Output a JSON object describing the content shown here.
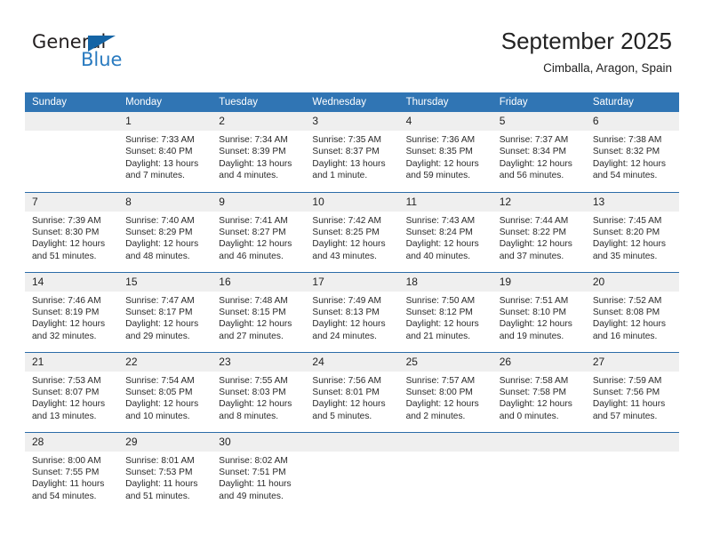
{
  "brand": {
    "name_part1": "General",
    "name_part2": "Blue",
    "accent_color": "#2a7bc0",
    "triangle_color": "#1464a5",
    "logo_icon": "triangle-play-icon"
  },
  "header": {
    "title": "September 2025",
    "subtitle": "Cimballa, Aragon, Spain"
  },
  "theme": {
    "header_row_bg": "#3075b4",
    "row_divider": "#2c6ca8",
    "daynum_bg": "#efefef"
  },
  "weekday_headers": [
    "Sunday",
    "Monday",
    "Tuesday",
    "Wednesday",
    "Thursday",
    "Friday",
    "Saturday"
  ],
  "weeks": [
    [
      {
        "day": "",
        "empty": true,
        "sunrise": "",
        "sunset": "",
        "daylight_line1": "",
        "daylight_line2": ""
      },
      {
        "day": "1",
        "sunrise": "Sunrise: 7:33 AM",
        "sunset": "Sunset: 8:40 PM",
        "daylight_line1": "Daylight: 13 hours",
        "daylight_line2": "and 7 minutes."
      },
      {
        "day": "2",
        "sunrise": "Sunrise: 7:34 AM",
        "sunset": "Sunset: 8:39 PM",
        "daylight_line1": "Daylight: 13 hours",
        "daylight_line2": "and 4 minutes."
      },
      {
        "day": "3",
        "sunrise": "Sunrise: 7:35 AM",
        "sunset": "Sunset: 8:37 PM",
        "daylight_line1": "Daylight: 13 hours",
        "daylight_line2": "and 1 minute."
      },
      {
        "day": "4",
        "sunrise": "Sunrise: 7:36 AM",
        "sunset": "Sunset: 8:35 PM",
        "daylight_line1": "Daylight: 12 hours",
        "daylight_line2": "and 59 minutes."
      },
      {
        "day": "5",
        "sunrise": "Sunrise: 7:37 AM",
        "sunset": "Sunset: 8:34 PM",
        "daylight_line1": "Daylight: 12 hours",
        "daylight_line2": "and 56 minutes."
      },
      {
        "day": "6",
        "sunrise": "Sunrise: 7:38 AM",
        "sunset": "Sunset: 8:32 PM",
        "daylight_line1": "Daylight: 12 hours",
        "daylight_line2": "and 54 minutes."
      }
    ],
    [
      {
        "day": "7",
        "sunrise": "Sunrise: 7:39 AM",
        "sunset": "Sunset: 8:30 PM",
        "daylight_line1": "Daylight: 12 hours",
        "daylight_line2": "and 51 minutes."
      },
      {
        "day": "8",
        "sunrise": "Sunrise: 7:40 AM",
        "sunset": "Sunset: 8:29 PM",
        "daylight_line1": "Daylight: 12 hours",
        "daylight_line2": "and 48 minutes."
      },
      {
        "day": "9",
        "sunrise": "Sunrise: 7:41 AM",
        "sunset": "Sunset: 8:27 PM",
        "daylight_line1": "Daylight: 12 hours",
        "daylight_line2": "and 46 minutes."
      },
      {
        "day": "10",
        "sunrise": "Sunrise: 7:42 AM",
        "sunset": "Sunset: 8:25 PM",
        "daylight_line1": "Daylight: 12 hours",
        "daylight_line2": "and 43 minutes."
      },
      {
        "day": "11",
        "sunrise": "Sunrise: 7:43 AM",
        "sunset": "Sunset: 8:24 PM",
        "daylight_line1": "Daylight: 12 hours",
        "daylight_line2": "and 40 minutes."
      },
      {
        "day": "12",
        "sunrise": "Sunrise: 7:44 AM",
        "sunset": "Sunset: 8:22 PM",
        "daylight_line1": "Daylight: 12 hours",
        "daylight_line2": "and 37 minutes."
      },
      {
        "day": "13",
        "sunrise": "Sunrise: 7:45 AM",
        "sunset": "Sunset: 8:20 PM",
        "daylight_line1": "Daylight: 12 hours",
        "daylight_line2": "and 35 minutes."
      }
    ],
    [
      {
        "day": "14",
        "sunrise": "Sunrise: 7:46 AM",
        "sunset": "Sunset: 8:19 PM",
        "daylight_line1": "Daylight: 12 hours",
        "daylight_line2": "and 32 minutes."
      },
      {
        "day": "15",
        "sunrise": "Sunrise: 7:47 AM",
        "sunset": "Sunset: 8:17 PM",
        "daylight_line1": "Daylight: 12 hours",
        "daylight_line2": "and 29 minutes."
      },
      {
        "day": "16",
        "sunrise": "Sunrise: 7:48 AM",
        "sunset": "Sunset: 8:15 PM",
        "daylight_line1": "Daylight: 12 hours",
        "daylight_line2": "and 27 minutes."
      },
      {
        "day": "17",
        "sunrise": "Sunrise: 7:49 AM",
        "sunset": "Sunset: 8:13 PM",
        "daylight_line1": "Daylight: 12 hours",
        "daylight_line2": "and 24 minutes."
      },
      {
        "day": "18",
        "sunrise": "Sunrise: 7:50 AM",
        "sunset": "Sunset: 8:12 PM",
        "daylight_line1": "Daylight: 12 hours",
        "daylight_line2": "and 21 minutes."
      },
      {
        "day": "19",
        "sunrise": "Sunrise: 7:51 AM",
        "sunset": "Sunset: 8:10 PM",
        "daylight_line1": "Daylight: 12 hours",
        "daylight_line2": "and 19 minutes."
      },
      {
        "day": "20",
        "sunrise": "Sunrise: 7:52 AM",
        "sunset": "Sunset: 8:08 PM",
        "daylight_line1": "Daylight: 12 hours",
        "daylight_line2": "and 16 minutes."
      }
    ],
    [
      {
        "day": "21",
        "sunrise": "Sunrise: 7:53 AM",
        "sunset": "Sunset: 8:07 PM",
        "daylight_line1": "Daylight: 12 hours",
        "daylight_line2": "and 13 minutes."
      },
      {
        "day": "22",
        "sunrise": "Sunrise: 7:54 AM",
        "sunset": "Sunset: 8:05 PM",
        "daylight_line1": "Daylight: 12 hours",
        "daylight_line2": "and 10 minutes."
      },
      {
        "day": "23",
        "sunrise": "Sunrise: 7:55 AM",
        "sunset": "Sunset: 8:03 PM",
        "daylight_line1": "Daylight: 12 hours",
        "daylight_line2": "and 8 minutes."
      },
      {
        "day": "24",
        "sunrise": "Sunrise: 7:56 AM",
        "sunset": "Sunset: 8:01 PM",
        "daylight_line1": "Daylight: 12 hours",
        "daylight_line2": "and 5 minutes."
      },
      {
        "day": "25",
        "sunrise": "Sunrise: 7:57 AM",
        "sunset": "Sunset: 8:00 PM",
        "daylight_line1": "Daylight: 12 hours",
        "daylight_line2": "and 2 minutes."
      },
      {
        "day": "26",
        "sunrise": "Sunrise: 7:58 AM",
        "sunset": "Sunset: 7:58 PM",
        "daylight_line1": "Daylight: 12 hours",
        "daylight_line2": "and 0 minutes."
      },
      {
        "day": "27",
        "sunrise": "Sunrise: 7:59 AM",
        "sunset": "Sunset: 7:56 PM",
        "daylight_line1": "Daylight: 11 hours",
        "daylight_line2": "and 57 minutes."
      }
    ],
    [
      {
        "day": "28",
        "sunrise": "Sunrise: 8:00 AM",
        "sunset": "Sunset: 7:55 PM",
        "daylight_line1": "Daylight: 11 hours",
        "daylight_line2": "and 54 minutes."
      },
      {
        "day": "29",
        "sunrise": "Sunrise: 8:01 AM",
        "sunset": "Sunset: 7:53 PM",
        "daylight_line1": "Daylight: 11 hours",
        "daylight_line2": "and 51 minutes."
      },
      {
        "day": "30",
        "sunrise": "Sunrise: 8:02 AM",
        "sunset": "Sunset: 7:51 PM",
        "daylight_line1": "Daylight: 11 hours",
        "daylight_line2": "and 49 minutes."
      },
      {
        "day": "",
        "empty": true,
        "sunrise": "",
        "sunset": "",
        "daylight_line1": "",
        "daylight_line2": ""
      },
      {
        "day": "",
        "empty": true,
        "sunrise": "",
        "sunset": "",
        "daylight_line1": "",
        "daylight_line2": ""
      },
      {
        "day": "",
        "empty": true,
        "sunrise": "",
        "sunset": "",
        "daylight_line1": "",
        "daylight_line2": ""
      },
      {
        "day": "",
        "empty": true,
        "sunrise": "",
        "sunset": "",
        "daylight_line1": "",
        "daylight_line2": ""
      }
    ]
  ]
}
